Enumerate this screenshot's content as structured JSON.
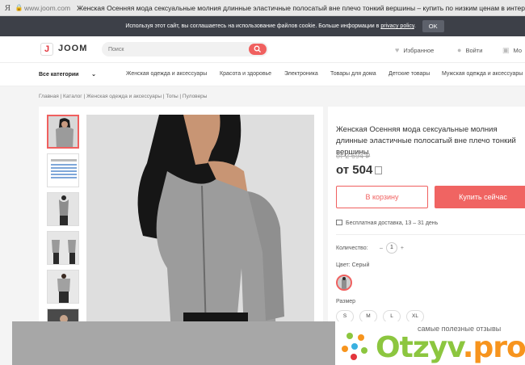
{
  "browser": {
    "yandex_glyph": "Я",
    "url": "www.joom.com",
    "title": "Женская Осенняя мода сексуальные молния длинные эластичные полосатый вне плечо тонкий вершины – купить по низким ценам в интер"
  },
  "cookie_bar": {
    "text": "Используя этот сайт, вы соглашаетесь на использование файлов cookie. Больше информации в",
    "link": "privacy policy",
    "ok": "OK"
  },
  "header": {
    "logo_mark": "J",
    "logo_text": "JOOM",
    "search_placeholder": "Поиск",
    "favorites": "Избранное",
    "login": "Войти",
    "cart": "Мо"
  },
  "nav": {
    "all_categories": "Все категории",
    "items": [
      "Женская одежда и аксессуары",
      "Красота и здоровье",
      "Электроника",
      "Товары для дома",
      "Детские товары",
      "Мужская одежда и аксессуары"
    ]
  },
  "breadcrumb": "Главная  |  Каталог  |  Женская одежда и аксессуары  |  Топы  |  Пуловеры",
  "product": {
    "title": "Женская Осенняя мода сексуальные молния длинные эластичные полосатый вне плечо тонкий вершины",
    "old_price": "от 2 694",
    "price": "от 504",
    "add_to_cart": "В корзину",
    "buy_now": "Купить сейчас",
    "shipping": "Бесплатная доставка, 13 – 31 день",
    "quantity_label": "Количество:",
    "quantity": "1",
    "color_label": "Цвет: Серый",
    "size_label": "Размер",
    "sizes": [
      "S",
      "M",
      "L",
      "XL"
    ]
  },
  "thumbnails": [
    "photo-front",
    "size-chart",
    "photo-full",
    "photo-pair",
    "photo-side",
    "photo-dark"
  ],
  "watermark": {
    "tagline": "самые полезные отзывы",
    "name_green": "Otzyv",
    "name_orange": ".pro"
  },
  "colors": {
    "accent": "#f0605f",
    "cookie_bg": "#3d4048",
    "watermark_green": "#8cc63f",
    "watermark_orange": "#f7941d"
  }
}
